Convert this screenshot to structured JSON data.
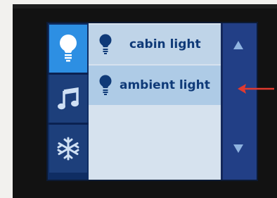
{
  "list": {
    "items": [
      {
        "label": "cabin light",
        "icon": "light-bulb-icon"
      },
      {
        "label": "ambient light",
        "icon": "light-bulb-icon"
      }
    ]
  },
  "categories": [
    {
      "icon": "light-bulb-icon",
      "active": true
    },
    {
      "icon": "music-note-icon",
      "active": false
    },
    {
      "icon": "snowflake-icon",
      "active": false
    }
  ],
  "scroll": {
    "up_icon": "up-arrow-icon",
    "down_icon": "down-arrow-icon"
  },
  "colors": {
    "screen_bg": "#d9e4ee",
    "active_category": "#2d8fe3",
    "label_text": "#0f3a78",
    "scrollbar": "#223f86",
    "pointer": "#e03a2f"
  }
}
